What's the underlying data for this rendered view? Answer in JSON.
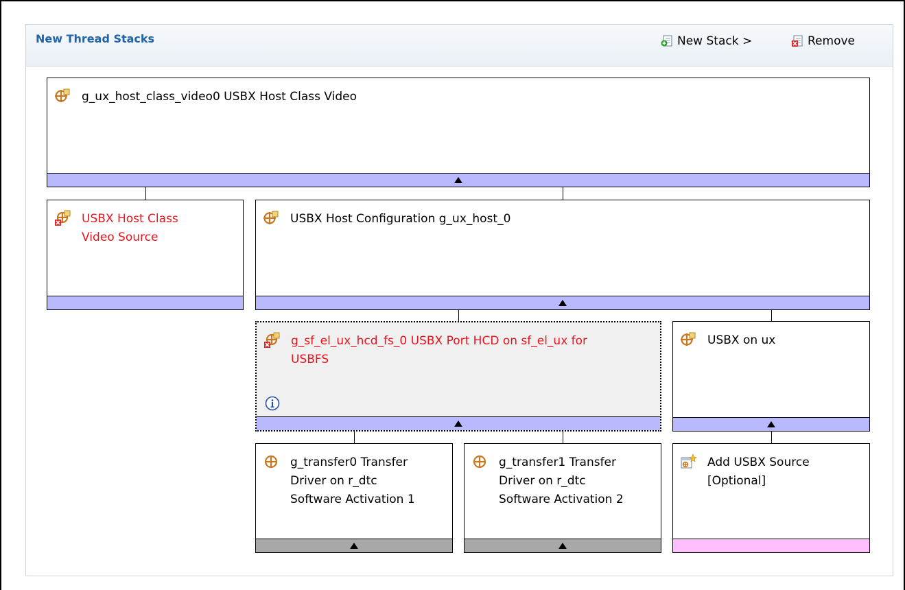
{
  "panel": {
    "title": "New Thread Stacks",
    "new_stack_label": "New Stack >",
    "remove_label": "Remove"
  },
  "nodes": {
    "video_class": {
      "label": "g_ux_host_class_video0 USBX Host Class Video",
      "bar": "purple",
      "expandable": true
    },
    "video_source": {
      "label_lines": [
        "USBX Host Class",
        "Video Source"
      ],
      "error": true,
      "bar": "purple"
    },
    "host_config": {
      "label": "USBX Host Configuration g_ux_host_0",
      "bar": "purple",
      "expandable": true
    },
    "hcd": {
      "label_lines": [
        "g_sf_el_ux_hcd_fs_0 USBX Port HCD on sf_el_ux for",
        "USBFS"
      ],
      "error": true,
      "selected": true,
      "bar": "purple",
      "expandable": true
    },
    "usbx_on_ux": {
      "label": "USBX on ux",
      "bar": "purple",
      "expandable": true
    },
    "transfer0": {
      "label_lines": [
        "g_transfer0 Transfer",
        "Driver on r_dtc",
        "Software Activation 1"
      ],
      "bar": "gray",
      "expandable": true
    },
    "transfer1": {
      "label_lines": [
        "g_transfer1 Transfer",
        "Driver on r_dtc",
        "Software Activation 2"
      ],
      "bar": "gray",
      "expandable": true
    },
    "add_source": {
      "label_lines": [
        "Add USBX Source",
        "[Optional]"
      ],
      "bar": "pink"
    }
  },
  "colors": {
    "title": "#1f63a8",
    "error_text": "#e8141e",
    "bar_purple": "#b9b9ff",
    "bar_gray": "#a8a8a8",
    "bar_pink": "#ffbfff",
    "icon_orange": "#c8781e"
  },
  "icons": {
    "module": "module-icon",
    "module_error": "module-error-icon",
    "add_source": "add-source-icon",
    "info": "info-icon",
    "new_stack": "new-stack-icon",
    "remove": "remove-icon"
  }
}
